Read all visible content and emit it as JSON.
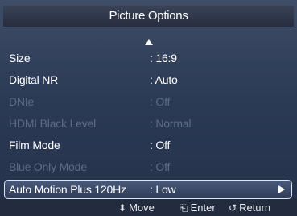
{
  "header": {
    "title": "Picture Options"
  },
  "menu": {
    "scroll_up_icon": "triangle-up-icon",
    "items": [
      {
        "label": "Size",
        "value": ": 16:9",
        "state": "active"
      },
      {
        "label": "Digital NR",
        "value": ": Auto",
        "state": "active"
      },
      {
        "label": "DNIe",
        "value": ": Off",
        "state": "disabled"
      },
      {
        "label": "HDMI Black Level",
        "value": ": Normal",
        "state": "disabled"
      },
      {
        "label": "Film Mode",
        "value": ": Off",
        "state": "active"
      },
      {
        "label": "Blue Only Mode",
        "value": ": Off",
        "state": "disabled"
      },
      {
        "label": "Auto Motion Plus 120Hz",
        "value": ": Low",
        "state": "selected",
        "arrow_icon": "triangle-right-icon"
      }
    ]
  },
  "footer": {
    "move": {
      "icon": "⬍",
      "label": "Move"
    },
    "enter": {
      "icon": "⎗",
      "label": "Enter"
    },
    "return": {
      "icon": "↺",
      "label": "Return"
    }
  },
  "colors": {
    "text_active": "#ffffff",
    "text_disabled": "#5d6b84",
    "panel": "#2b3a55",
    "highlight_border": "#dfe6f2"
  }
}
